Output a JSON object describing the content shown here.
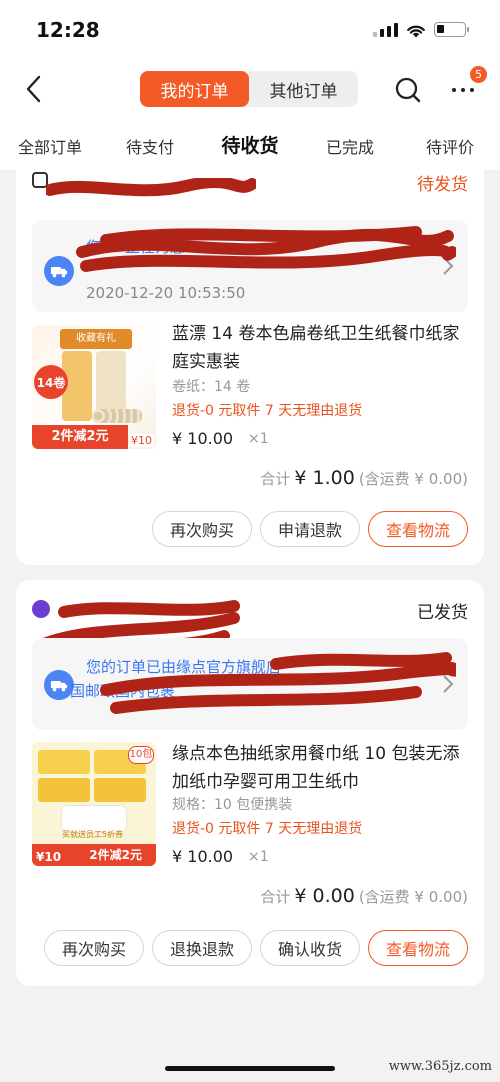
{
  "status_bar": {
    "time": "12:28"
  },
  "header": {
    "segments": [
      {
        "label": "我的订单",
        "active": true
      },
      {
        "label": "其他订单",
        "active": false
      }
    ],
    "badge_count": "5"
  },
  "tabs": [
    {
      "label": "全部订单"
    },
    {
      "label": "待支付"
    },
    {
      "label": "待收货",
      "active": true
    },
    {
      "label": "已完成"
    },
    {
      "label": "待评价"
    }
  ],
  "orders": [
    {
      "status": "待发货",
      "status_color": "#e8541f",
      "logistics_text": "您  ...  正在为您",
      "logistics_time": "2020-12-20 10:53:50",
      "product_title": "蓝漂 14 卷本色扁卷纸卫生纸餐巾纸家庭实惠装",
      "spec": "卷纸：14 卷",
      "policy": "退货-0 元取件 7 天无理由退货",
      "price": "¥ 10.00",
      "qty": "×1",
      "total_label": "合计",
      "total_amount": "¥ 1.00",
      "shipping_note": "(含运费 ¥ 0.00)",
      "thumb_tag1": "14卷",
      "thumb_tag2": "2件减2元",
      "thumb_tag3": "收藏有礼",
      "thumb_price": "¥10",
      "buttons": [
        {
          "label": "再次购买",
          "primary": false
        },
        {
          "label": "申请退款",
          "primary": false
        },
        {
          "label": "查看物流",
          "primary": true
        }
      ]
    },
    {
      "status": "已发货",
      "status_color": "#222222",
      "logistics_text": "您的订单已由缘点官方旗舰店",
      "logistics_text2": "国邮政国内包裹",
      "product_title": "缘点本色抽纸家用餐巾纸 10 包装无添加纸巾孕婴可用卫生纸巾",
      "spec": "规格：10 包便携装",
      "policy": "退货-0 元取件 7 天无理由退货",
      "price": "¥ 10.00",
      "qty": "×1",
      "total_label": "合计",
      "total_amount": "¥ 0.00",
      "shipping_note": "(含运费 ¥ 0.00)",
      "thumb_tag1": "10包",
      "thumb_tag2": "2件减2元",
      "thumb_tag3": "买就送员工5折券",
      "thumb_price": "¥10",
      "buttons": [
        {
          "label": "再次购买",
          "primary": false
        },
        {
          "label": "退换退款",
          "primary": false
        },
        {
          "label": "确认收货",
          "primary": false
        },
        {
          "label": "查看物流",
          "primary": true
        }
      ]
    }
  ],
  "watermark": "www.365jz.com",
  "colors": {
    "accent": "#f35a25",
    "link_blue": "#3b78f0",
    "redact": "#b02418"
  }
}
